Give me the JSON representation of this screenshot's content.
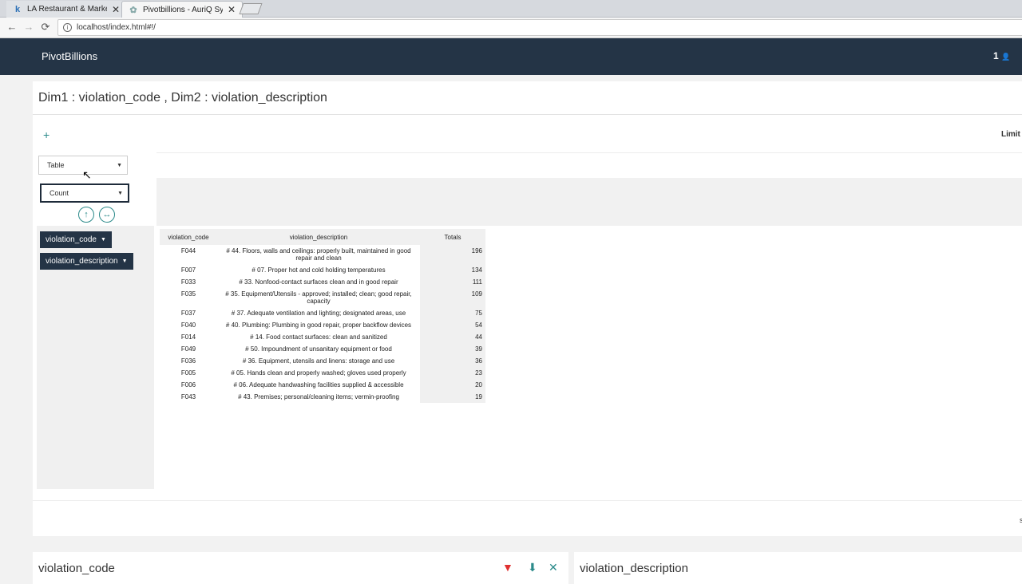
{
  "browser": {
    "tabs": [
      {
        "label": "LA Restaurant & Market I",
        "favicon": "k"
      },
      {
        "label": "Pivotbillions - AuriQ Syst",
        "favicon": "✿"
      }
    ],
    "url": "localhost/index.html#!/"
  },
  "app": {
    "brand": "PivotBillions",
    "user_badge": "1"
  },
  "pivot": {
    "title": "Dim1 : violation_code , Dim2 : violation_description",
    "add_label": "+",
    "limit_label": "Limit",
    "view_select": "Table",
    "agg_select": "Count",
    "dims": [
      "violation_code",
      "violation_description"
    ],
    "columns": [
      "violation_code",
      "violation_description",
      "Totals"
    ],
    "rows": [
      {
        "code": "F044",
        "desc": "# 44. Floors, walls and ceilings: properly built, maintained in good repair and clean",
        "total": "196"
      },
      {
        "code": "F007",
        "desc": "# 07. Proper hot and cold holding temperatures",
        "total": "134"
      },
      {
        "code": "F033",
        "desc": "# 33. Nonfood-contact surfaces clean and in good repair",
        "total": "111"
      },
      {
        "code": "F035",
        "desc": "# 35. Equipment/Utensils - approved; installed; clean; good repair, capacity",
        "total": "109"
      },
      {
        "code": "F037",
        "desc": "# 37. Adequate ventilation and lighting; designated areas, use",
        "total": "75"
      },
      {
        "code": "F040",
        "desc": "# 40. Plumbing: Plumbing in good repair, proper backflow devices",
        "total": "54"
      },
      {
        "code": "F014",
        "desc": "# 14. Food contact surfaces: clean and sanitized",
        "total": "44"
      },
      {
        "code": "F049",
        "desc": "# 50. Impoundment of unsanitary equipment or food",
        "total": "39"
      },
      {
        "code": "F036",
        "desc": "# 36. Equipment, utensils and linens: storage and use",
        "total": "36"
      },
      {
        "code": "F005",
        "desc": "# 05. Hands clean and properly washed; gloves used properly",
        "total": "23"
      },
      {
        "code": "F006",
        "desc": "# 06. Adequate handwashing facilities supplied & accessible",
        "total": "20"
      },
      {
        "code": "F043",
        "desc": "# 43. Premises; personal/cleaning items; vermin-proofing",
        "total": "19"
      }
    ]
  },
  "bottom": {
    "left_title": "violation_code",
    "right_title": "violation_description"
  },
  "colors": {
    "nav": "#243446",
    "accent": "#2b8a8a",
    "filter_icon": "#e03030"
  }
}
